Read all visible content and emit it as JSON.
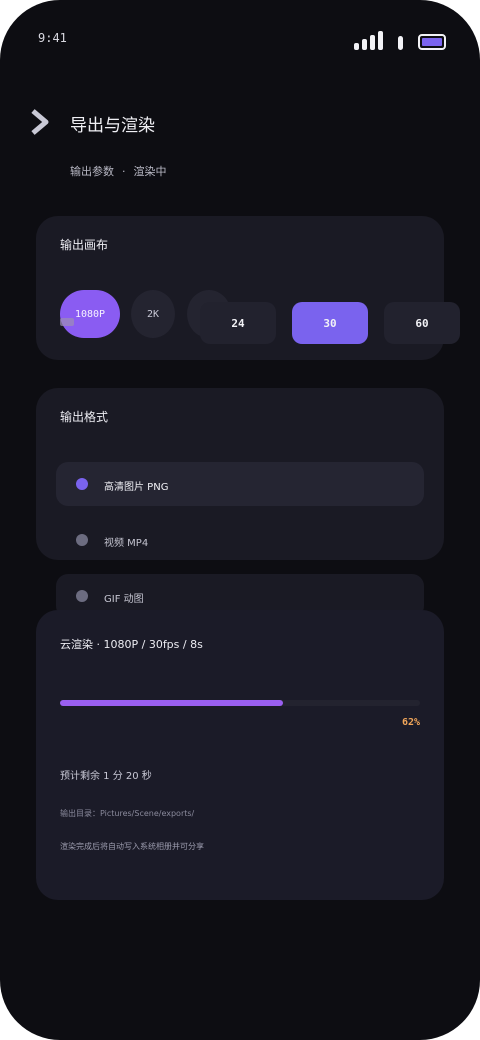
{
  "status_bar": {
    "time": "9:41"
  },
  "colors": {
    "accent": "#7a63ee",
    "progress": "#9a5ff0",
    "percent": "#f1a65a",
    "card": "#1a1a24",
    "background": "#0d0d12"
  },
  "header": {
    "title": "导出与渲染",
    "breadcrumb": [
      "输出参数",
      "渲染中"
    ],
    "breadcrumb_sep": "·",
    "back_icon": "chevron-right-icon"
  },
  "canvas_card": {
    "title": "输出画布",
    "resolutions": [
      {
        "label": "1080P",
        "selected": true
      },
      {
        "label": "2K",
        "selected": false
      },
      {
        "label": "",
        "selected": false
      }
    ],
    "fps_options": [
      {
        "label": "24",
        "selected": false
      },
      {
        "label": "30",
        "selected": true
      },
      {
        "label": "60",
        "selected": false
      }
    ]
  },
  "format_card": {
    "title": "输出格式",
    "options": [
      {
        "label": "高清图片 PNG",
        "selected": true
      },
      {
        "label": "视频 MP4",
        "selected": false
      },
      {
        "label": "GIF 动图",
        "selected": false
      }
    ]
  },
  "render_card": {
    "summary": "云渲染 · 1080P / 30fps / 8s",
    "progress": 0.62,
    "percent_label": "62%",
    "remaining": "预计剩余 1 分 20 秒",
    "output_dir": "输出目录：Pictures/Scene/exports/",
    "note": "渲染完成后将自动写入系统相册并可分享"
  }
}
